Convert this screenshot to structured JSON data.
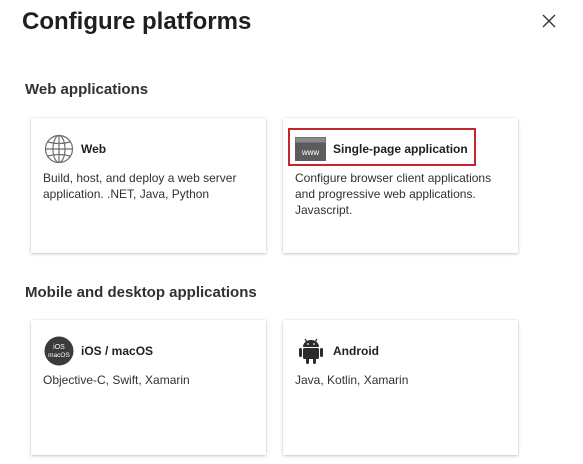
{
  "panel": {
    "title": "Configure platforms"
  },
  "sections": {
    "web": {
      "title": "Web applications"
    },
    "mobile": {
      "title": "Mobile and desktop applications"
    }
  },
  "cards": {
    "web": {
      "name": "Web",
      "description": "Build, host, and deploy a web server application. .NET, Java, Python",
      "icon": "globe-icon"
    },
    "spa": {
      "name": "Single-page application",
      "description": "Configure browser client applications and progressive web applications. Javascript.",
      "icon": "browser-window-icon",
      "icon_text": "www",
      "highlighted": true
    },
    "ios": {
      "name": "iOS / macOS",
      "description": "Objective-C, Swift, Xamarin",
      "icon": "ios-macos-icon",
      "icon_text_top": "iOS",
      "icon_text_bottom": "macOS"
    },
    "android": {
      "name": "Android",
      "description": "Java, Kotlin, Xamarin",
      "icon": "android-icon"
    }
  },
  "colors": {
    "highlight_border": "#c4262e",
    "title_text": "#201f1e",
    "body_text": "#323130"
  }
}
